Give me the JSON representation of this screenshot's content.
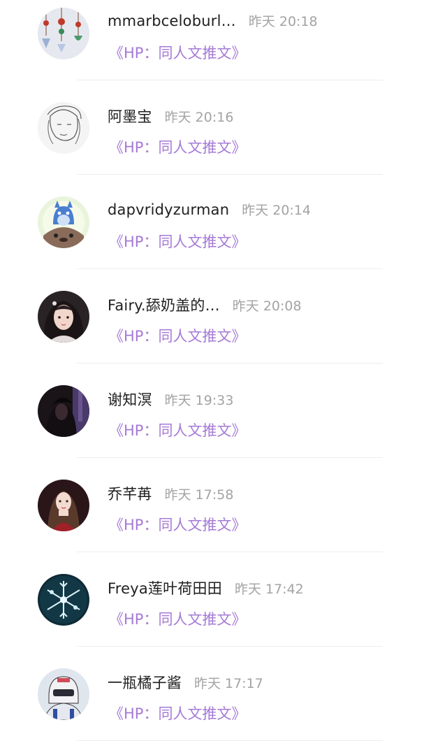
{
  "comments": [
    {
      "name": "mmarbceloburl…",
      "time": "昨天 20:18",
      "link": "《HP：同人文推文》",
      "avatar_icon": "hanging-charms-avatar-icon"
    },
    {
      "name": "阿墨宝",
      "time": "昨天 20:16",
      "link": "《HP：同人文推文》",
      "avatar_icon": "sketch-portrait-avatar-icon"
    },
    {
      "name": "dapvridyzurman",
      "time": "昨天 20:14",
      "link": "《HP：同人文推文》",
      "avatar_icon": "totoro-avatar-icon"
    },
    {
      "name": "Fairy.舔奶盖的…",
      "time": "昨天 20:08",
      "link": "《HP：同人文推文》",
      "avatar_icon": "girl-portrait-avatar-icon"
    },
    {
      "name": "谢知溟",
      "time": "昨天 19:33",
      "link": "《HP：同人文推文》",
      "avatar_icon": "dark-figure-avatar-icon"
    },
    {
      "name": "乔芊苒",
      "time": "昨天 17:58",
      "link": "《HP：同人文推文》",
      "avatar_icon": "girl-red-dress-avatar-icon"
    },
    {
      "name": "Freya莲叶荷田田",
      "time": "昨天 17:42",
      "link": "《HP：同人文推文》",
      "avatar_icon": "snowflake-avatar-icon"
    },
    {
      "name": "一瓶橘子酱",
      "time": "昨天 17:17",
      "link": "《HP：同人文推文》",
      "avatar_icon": "helmet-figure-avatar-icon"
    }
  ],
  "colors": {
    "name": "#1f1f1f",
    "time": "#a3a3a3",
    "link": "#a57ad6",
    "divider": "#ededed"
  }
}
